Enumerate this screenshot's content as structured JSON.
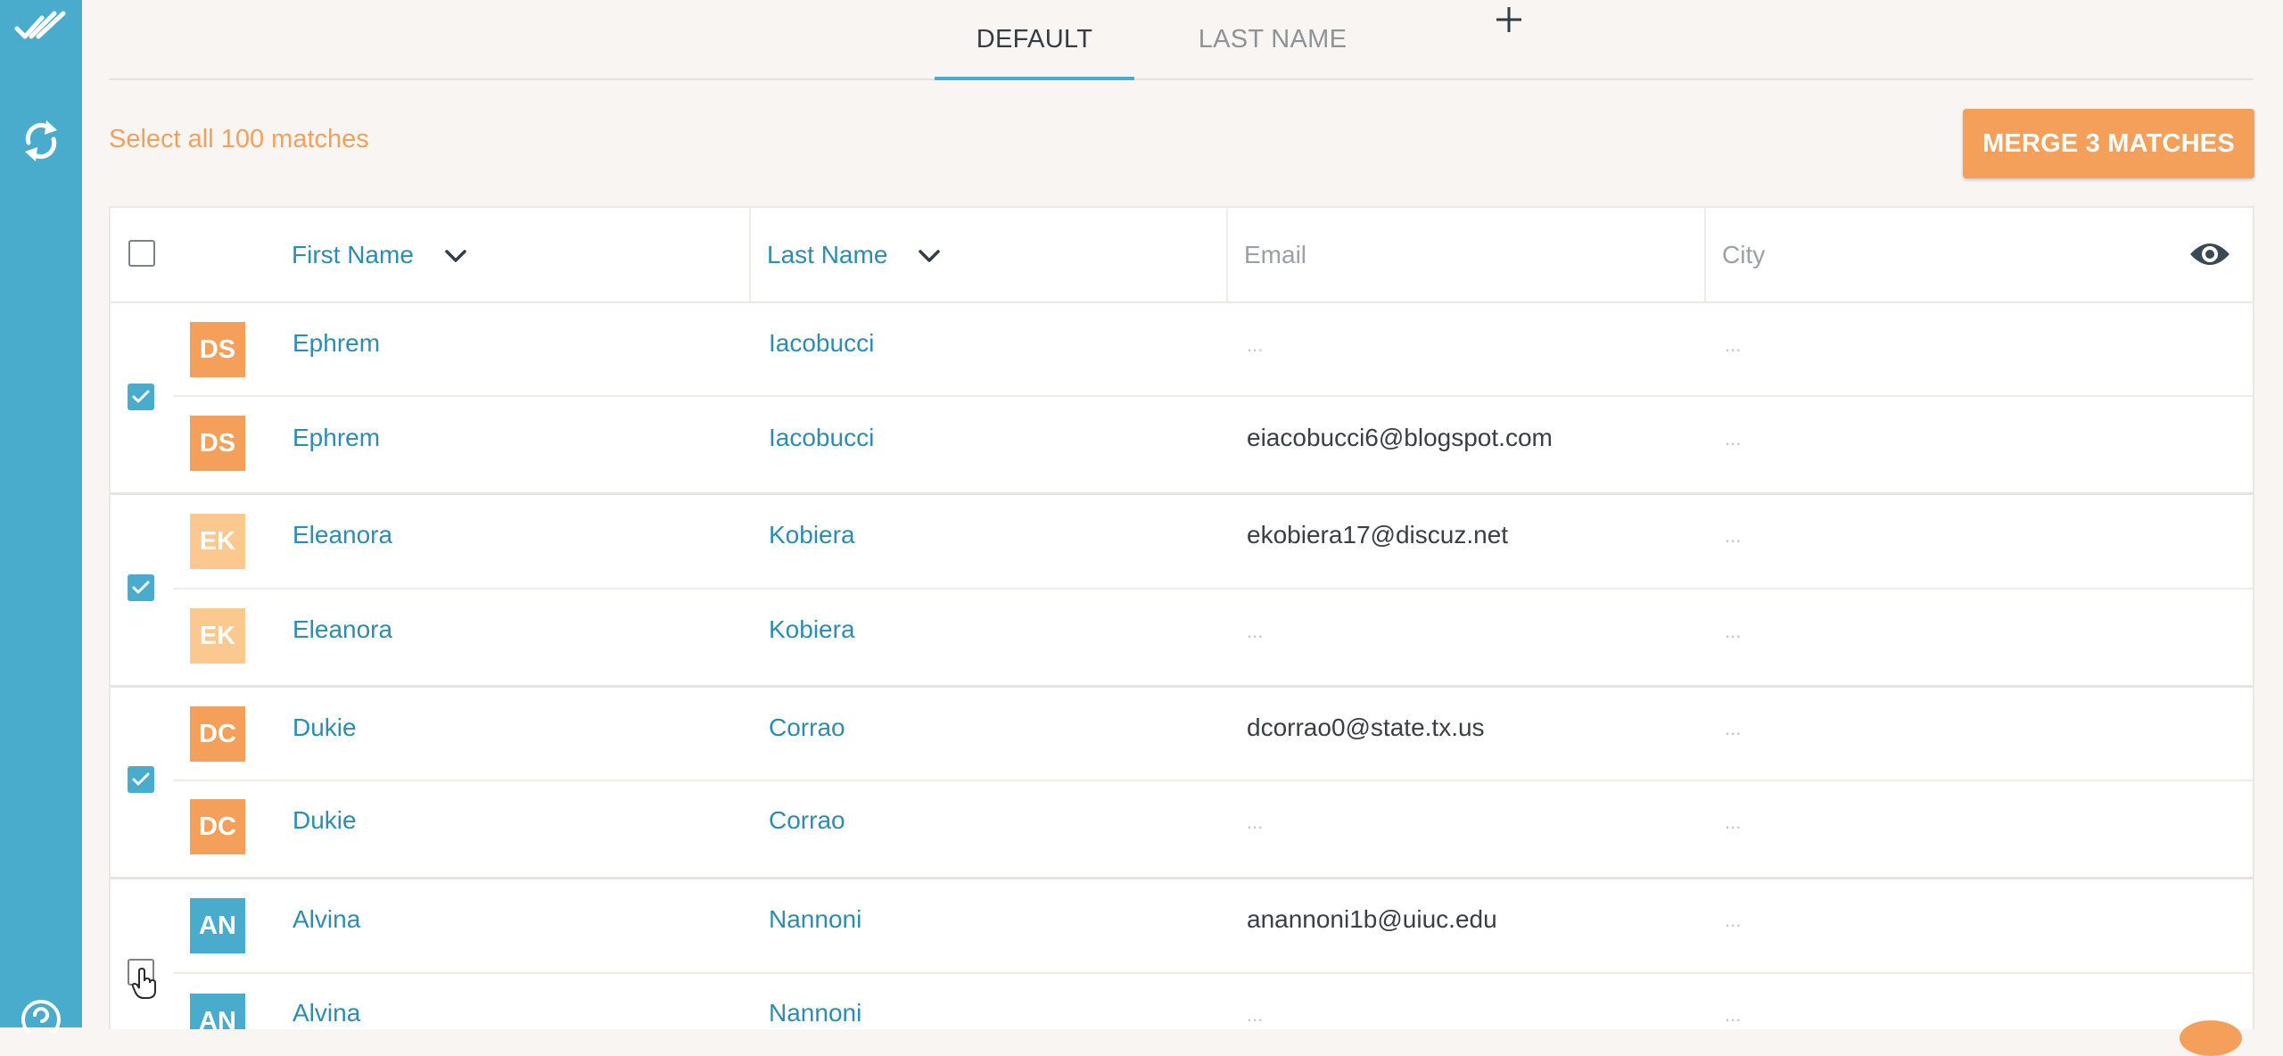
{
  "sidebar": {
    "icons": [
      "double-check-icon",
      "sync-icon",
      "help-icon"
    ]
  },
  "tabs": [
    {
      "label": "DEFAULT",
      "active": true
    },
    {
      "label": "LAST NAME",
      "active": false
    }
  ],
  "toolbar": {
    "select_all_label": "Select all 100 matches",
    "merge_button_label": "MERGE 3 MATCHES"
  },
  "table": {
    "columns": [
      {
        "label": "First Name",
        "sortable": true
      },
      {
        "label": "Last Name",
        "sortable": true
      },
      {
        "label": "Email",
        "sortable": false
      },
      {
        "label": "City",
        "sortable": false
      }
    ],
    "groups": [
      {
        "selected": true,
        "rows": [
          {
            "initials": "DS",
            "first": "Ephrem",
            "last": "Iacobucci",
            "email": "...",
            "city": "..."
          },
          {
            "initials": "DS",
            "first": "Ephrem",
            "last": "Iacobucci",
            "email": "eiacobucci6@blogspot.com",
            "city": "..."
          }
        ]
      },
      {
        "selected": true,
        "rows": [
          {
            "initials": "EK",
            "first": "Eleanora",
            "last": "Kobiera",
            "email": "ekobiera17@discuz.net",
            "city": "..."
          },
          {
            "initials": "EK",
            "first": "Eleanora",
            "last": "Kobiera",
            "email": "...",
            "city": "..."
          }
        ]
      },
      {
        "selected": true,
        "rows": [
          {
            "initials": "DC",
            "first": "Dukie",
            "last": "Corrao",
            "email": "dcorrao0@state.tx.us",
            "city": "..."
          },
          {
            "initials": "DC",
            "first": "Dukie",
            "last": "Corrao",
            "email": "...",
            "city": "..."
          }
        ]
      },
      {
        "selected": false,
        "rows": [
          {
            "initials": "AN",
            "first": "Alvina",
            "last": "Nannoni",
            "email": "anannoni1b@uiuc.edu",
            "city": "..."
          },
          {
            "initials": "AN",
            "first": "Alvina",
            "last": "Nannoni",
            "email": "...",
            "city": "..."
          }
        ]
      }
    ]
  },
  "colors": {
    "sidebar": "#4aaccd",
    "accent_orange": "#f5a05a",
    "link_blue": "#2e8cb0",
    "avatar_orange": "#f5a05a",
    "avatar_light_orange": "#fbc88f",
    "avatar_blue": "#4aaccd"
  }
}
